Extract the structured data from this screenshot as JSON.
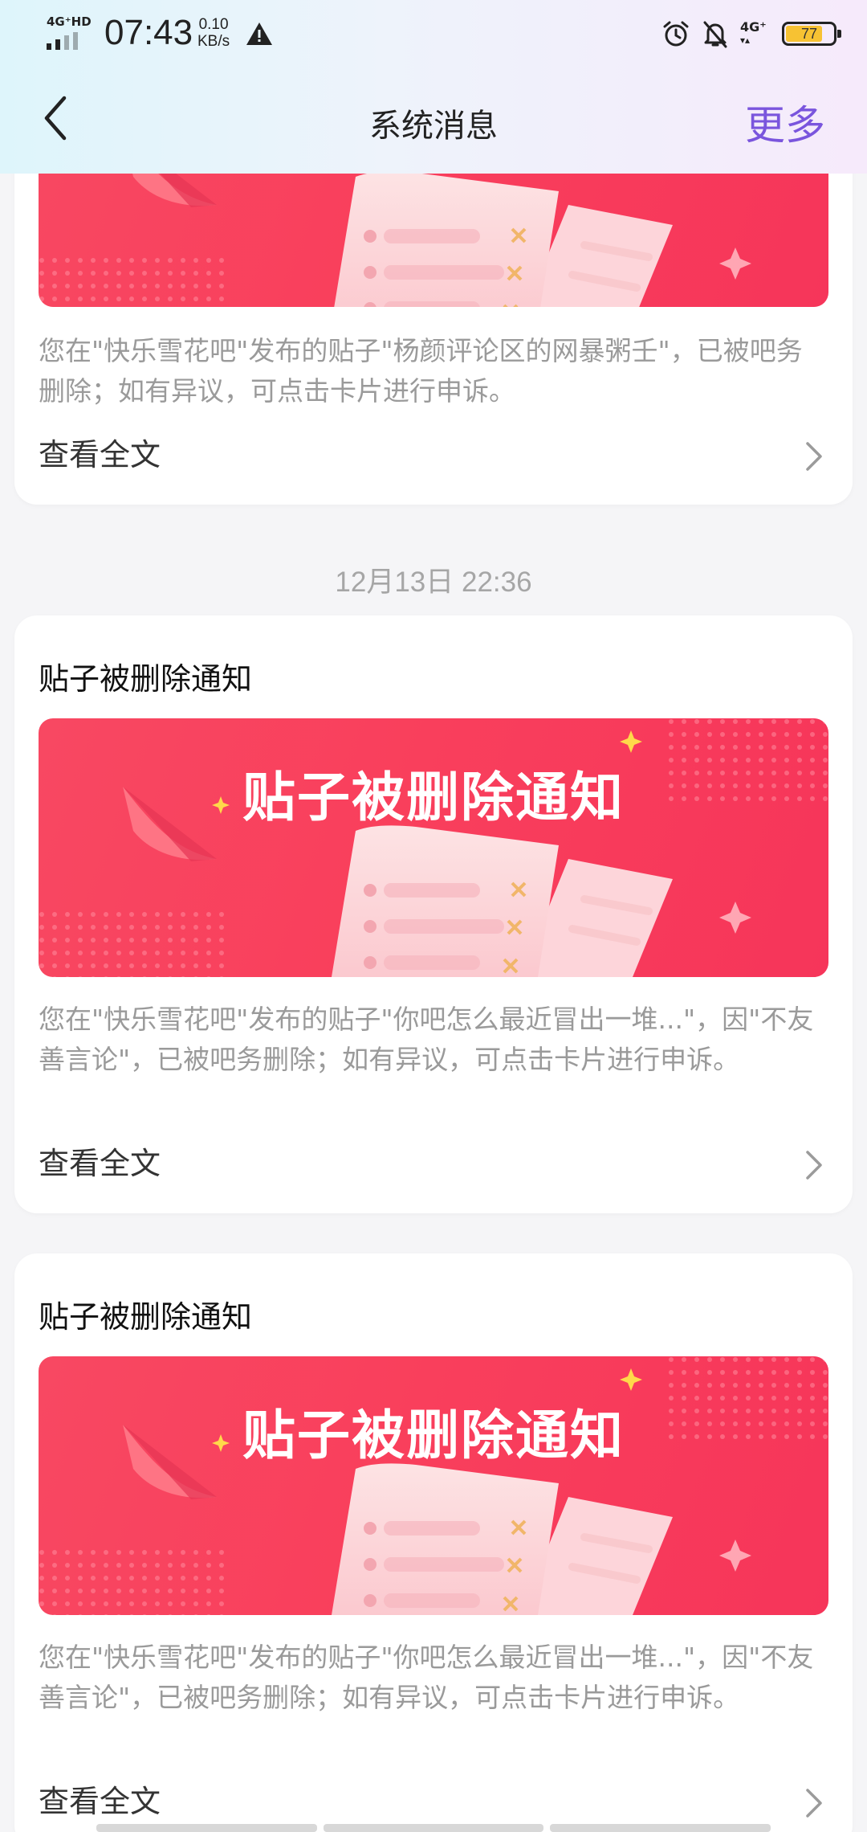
{
  "status_bar": {
    "network_label": "4G⁺HD",
    "time": "07:43",
    "speed_value": "0.10",
    "speed_unit": "KB/s",
    "net_right": "4G⁺",
    "battery": "77"
  },
  "nav": {
    "title": "系统消息",
    "more": "更多"
  },
  "messages": [
    {
      "desc": "您在\"快乐雪花吧\"发布的贴子\"杨颜评论区的网暴粥壬\"，已被吧务删除；如有异议，可点击卡片进行申诉。",
      "read_more": "查看全文"
    },
    {
      "timestamp": "12月13日 22:36",
      "title": "贴子被删除通知",
      "banner": "贴子被删除通知",
      "desc": "您在\"快乐雪花吧\"发布的贴子\"你吧怎么最近冒出一堆...\"，因\"不友善言论\"，已被吧务删除；如有异议，可点击卡片进行申诉。",
      "read_more": "查看全文"
    },
    {
      "title": "贴子被删除通知",
      "banner": "贴子被删除通知",
      "desc": "您在\"快乐雪花吧\"发布的贴子\"你吧怎么最近冒出一堆...\"，因\"不友善言论\"，已被吧务删除；如有异议，可点击卡片进行申诉。",
      "read_more": "查看全文"
    }
  ],
  "colors": {
    "accent": "#7a55dd",
    "banner_red": "#f84862",
    "battery_yellow": "#f7c233"
  }
}
